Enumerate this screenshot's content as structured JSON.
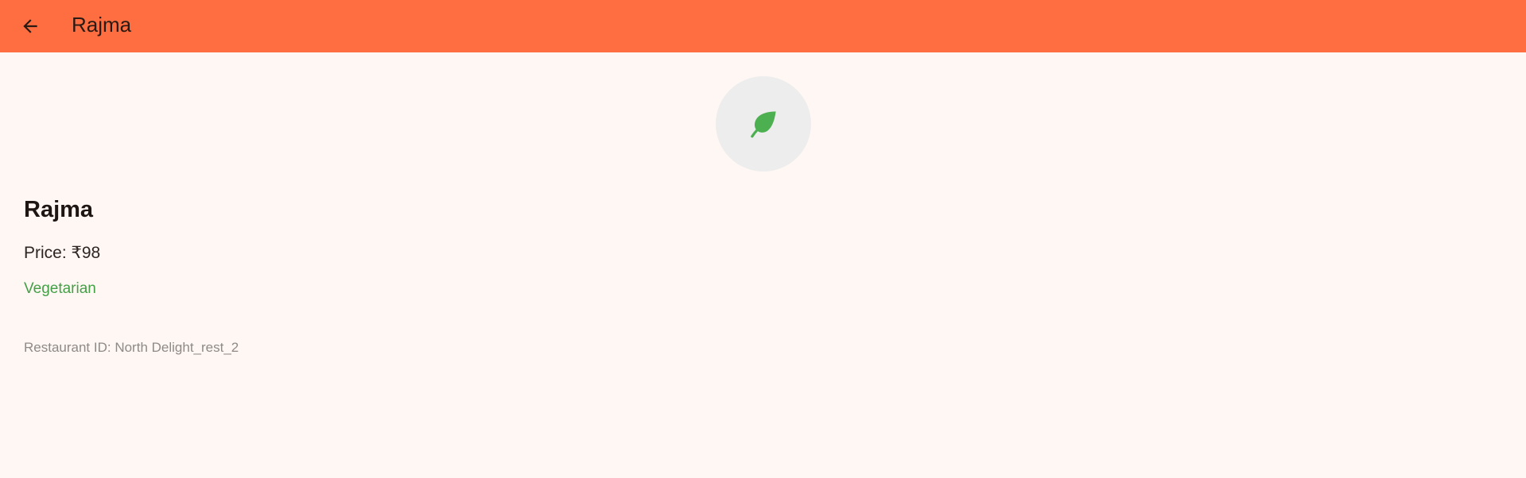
{
  "app_bar": {
    "title": "Rajma",
    "back_icon": "arrow-back-icon",
    "background": "#FF6E40"
  },
  "item": {
    "icon": "leaf-icon",
    "icon_color": "#4CAF50",
    "name": "Rajma",
    "price": "Price: ₹98",
    "type": "Vegetarian",
    "type_color": "#43A047",
    "restaurant_id": "Restaurant ID: North Delight_rest_2"
  }
}
